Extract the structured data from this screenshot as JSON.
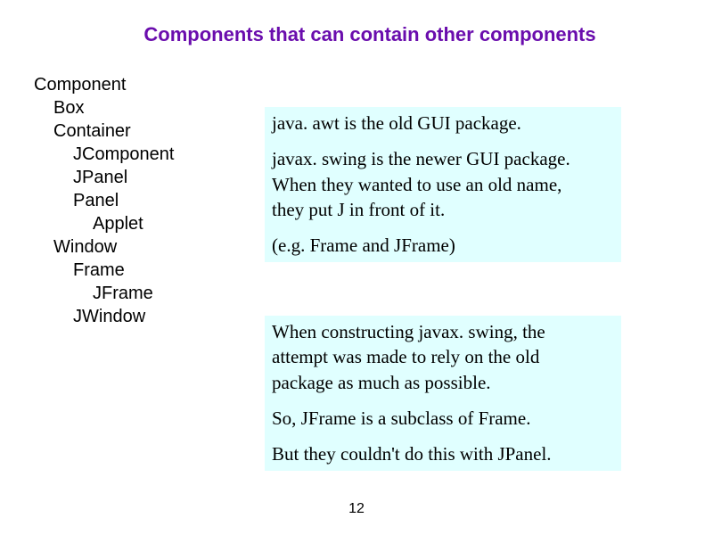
{
  "title": "Components that can contain other components",
  "hierarchy": {
    "l0": "Component",
    "l1a": "Box",
    "l1b": "Container",
    "l2a": "JComponent",
    "l2b": "JPanel",
    "l2c": "Panel",
    "l3a": "Applet",
    "l1c": "Window",
    "l2d": "Frame",
    "l3b": "JFrame",
    "l2e": "JWindow"
  },
  "box1": {
    "p1": "java. awt is the old GUI package.",
    "p2a": "javax. swing is the newer GUI package.",
    "p2b": "When they wanted to use an old name,",
    "p2c": "they put J in front of it.",
    "p3": "(e.g. Frame and JFrame)"
  },
  "box2": {
    "p1a": "When constructing javax. swing, the",
    "p1b": "attempt was made to rely on the old",
    "p1c": "package as much as possible.",
    "p2": "So, JFrame is a subclass of Frame.",
    "p3": "But they couldn't do this with JPanel."
  },
  "page_number": "12"
}
